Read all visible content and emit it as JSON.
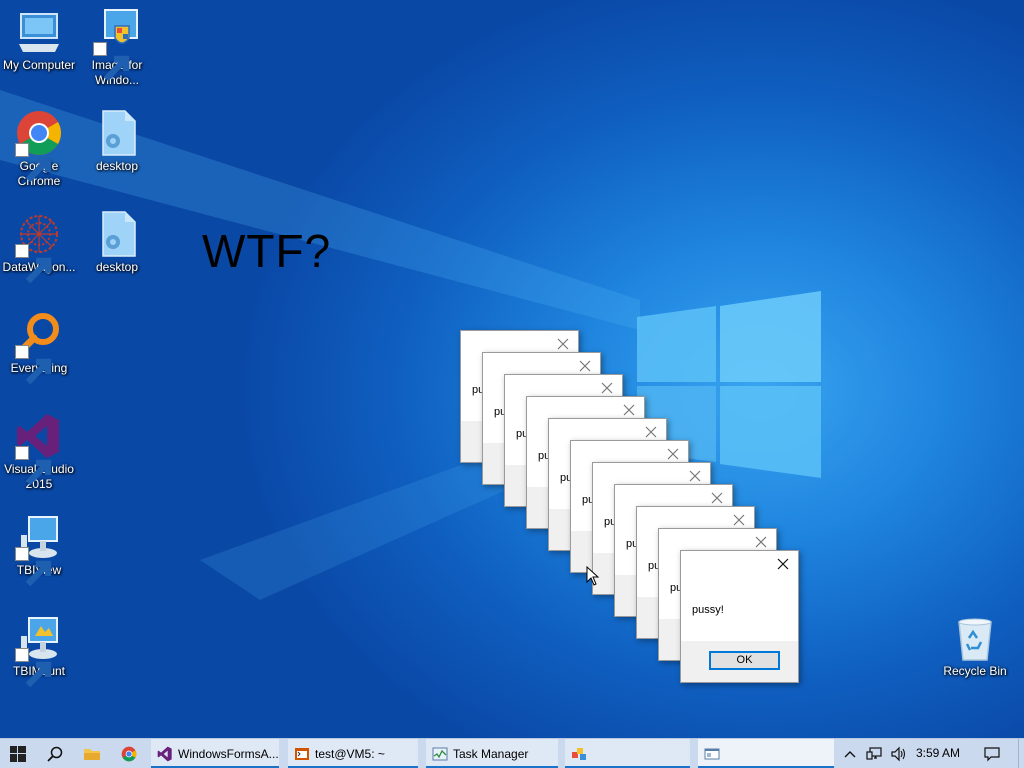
{
  "desktop": {
    "icons": [
      {
        "label": "My Computer"
      },
      {
        "label": "Image for Windo..."
      },
      {
        "label": "Google Chrome"
      },
      {
        "label": "desktop"
      },
      {
        "label": "DataWagon..."
      },
      {
        "label": "desktop"
      },
      {
        "label": "Everything"
      },
      {
        "label": "Visual Studio 2015"
      },
      {
        "label": "TBIView"
      },
      {
        "label": "TBIMount"
      },
      {
        "label": "Recycle Bin"
      }
    ],
    "overlay_text": "WTF?"
  },
  "dialogs": {
    "stack_count": 11,
    "partial_message": "pu",
    "front": {
      "message": "pussy!",
      "ok_label": "OK"
    }
  },
  "taskbar": {
    "apps": [
      {
        "label": "WindowsFormsA...",
        "icon": "visual-studio-icon"
      },
      {
        "label": "test@VM5: ~",
        "icon": "terminal-icon"
      },
      {
        "label": "Task Manager",
        "icon": "task-manager-icon"
      },
      {
        "label": "",
        "icon": "app-icon"
      },
      {
        "label": "",
        "icon": "window-icon"
      }
    ],
    "clock": "3:59 AM"
  },
  "colors": {
    "accent": "#0078d7",
    "taskbar": "#cbd9ee",
    "desktop": "#1f85df"
  }
}
